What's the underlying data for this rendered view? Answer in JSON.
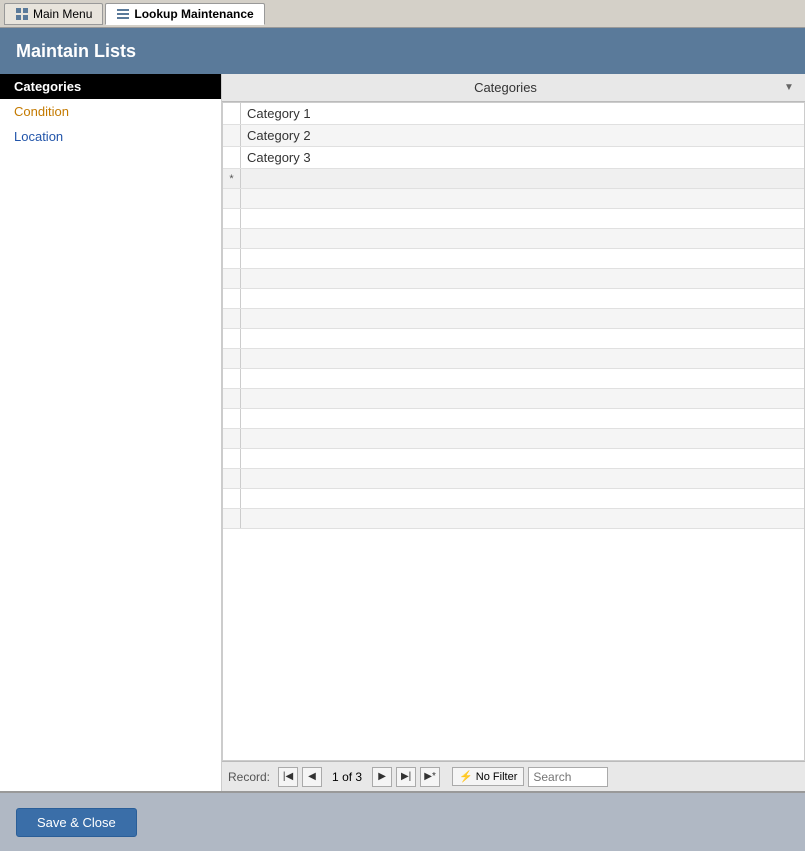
{
  "tabs": [
    {
      "id": "main-menu",
      "label": "Main Menu",
      "active": false,
      "icon": "grid-icon"
    },
    {
      "id": "lookup-maintenance",
      "label": "Lookup Maintenance",
      "active": true,
      "icon": "list-icon"
    }
  ],
  "header": {
    "title": "Maintain Lists"
  },
  "sidebar": {
    "items": [
      {
        "id": "categories",
        "label": "Categories",
        "selected": true,
        "style": "selected"
      },
      {
        "id": "condition",
        "label": "Condition",
        "style": "orange"
      },
      {
        "id": "location",
        "label": "Location",
        "style": "blue"
      }
    ]
  },
  "grid": {
    "column_header": "Categories",
    "rows": [
      {
        "id": 1,
        "value": "Category 1",
        "indicator": "",
        "is_new": false
      },
      {
        "id": 2,
        "value": "Category 2",
        "indicator": "",
        "is_new": false
      },
      {
        "id": 3,
        "value": "Category 3",
        "indicator": "",
        "is_new": false
      }
    ],
    "new_row_indicator": "*"
  },
  "navigation": {
    "record_label": "Record:",
    "current": "1",
    "total": "3",
    "of_label": "of",
    "no_filter_label": "No Filter",
    "search_placeholder": "Search",
    "buttons": {
      "first": "◀|",
      "prev": "◀",
      "next": "▶",
      "last": "|▶",
      "new": "▶*"
    }
  },
  "footer": {
    "save_close_label": "Save & Close"
  }
}
